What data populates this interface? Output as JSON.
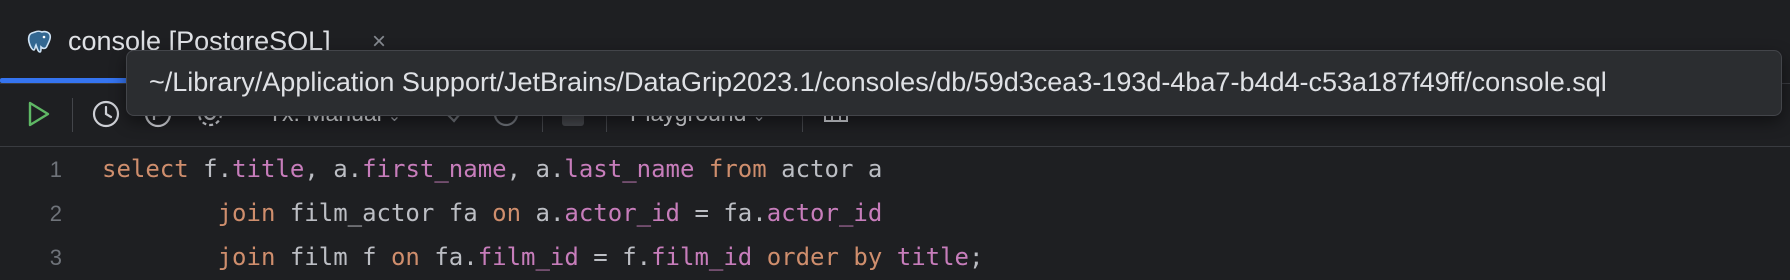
{
  "tab": {
    "title": "console [PostgreSQL]",
    "close_label": "×",
    "icon": "postgresql-elephant-icon"
  },
  "toolbar": {
    "execute_icon": "play-icon",
    "history_icon": "history-clock-icon",
    "profile_icon": "explain-plan-icon",
    "settings_icon": "gear-icon",
    "tx_mode": "Tx: Manual",
    "commit_icon": "checkmark-icon",
    "rollback_icon": "undo-icon",
    "stop_icon": "stop-icon",
    "mode": "Playground",
    "layout_icon": "table-view-icon"
  },
  "tooltip": {
    "text": "~/Library/Application Support/JetBrains/DataGrip2023.1/consoles/db/59d3cea3-193d-4ba7-b4d4-c53a187f49ff/console.sql"
  },
  "editor": {
    "lines": [
      {
        "number": "1",
        "tokens": [
          {
            "t": "select",
            "c": "kw"
          },
          {
            "t": " f.",
            "c": ""
          },
          {
            "t": "title",
            "c": "fld"
          },
          {
            "t": ", a.",
            "c": ""
          },
          {
            "t": "first_name",
            "c": "fld"
          },
          {
            "t": ", a.",
            "c": ""
          },
          {
            "t": "last_name",
            "c": "fld"
          },
          {
            "t": " ",
            "c": ""
          },
          {
            "t": "from",
            "c": "kw"
          },
          {
            "t": " actor a",
            "c": ""
          }
        ]
      },
      {
        "number": "2",
        "tokens": [
          {
            "t": "        ",
            "c": ""
          },
          {
            "t": "join",
            "c": "kw"
          },
          {
            "t": " film_actor fa ",
            "c": ""
          },
          {
            "t": "on",
            "c": "kw"
          },
          {
            "t": " a.",
            "c": ""
          },
          {
            "t": "actor_id",
            "c": "fld"
          },
          {
            "t": " = fa.",
            "c": ""
          },
          {
            "t": "actor_id",
            "c": "fld"
          }
        ]
      },
      {
        "number": "3",
        "tokens": [
          {
            "t": "        ",
            "c": ""
          },
          {
            "t": "join",
            "c": "kw"
          },
          {
            "t": " film f ",
            "c": ""
          },
          {
            "t": "on",
            "c": "kw"
          },
          {
            "t": " fa.",
            "c": ""
          },
          {
            "t": "film_id",
            "c": "fld"
          },
          {
            "t": " = f.",
            "c": ""
          },
          {
            "t": "film_id",
            "c": "fld"
          },
          {
            "t": " ",
            "c": ""
          },
          {
            "t": "order by",
            "c": "kw"
          },
          {
            "t": " ",
            "c": ""
          },
          {
            "t": "title",
            "c": "fld"
          },
          {
            "t": ";",
            "c": ""
          }
        ]
      }
    ]
  },
  "colors": {
    "background": "#1e1f22",
    "accent": "#3574f0",
    "keyword": "#cf8e6d",
    "field": "#c77dbb",
    "run": "#5fb865"
  }
}
